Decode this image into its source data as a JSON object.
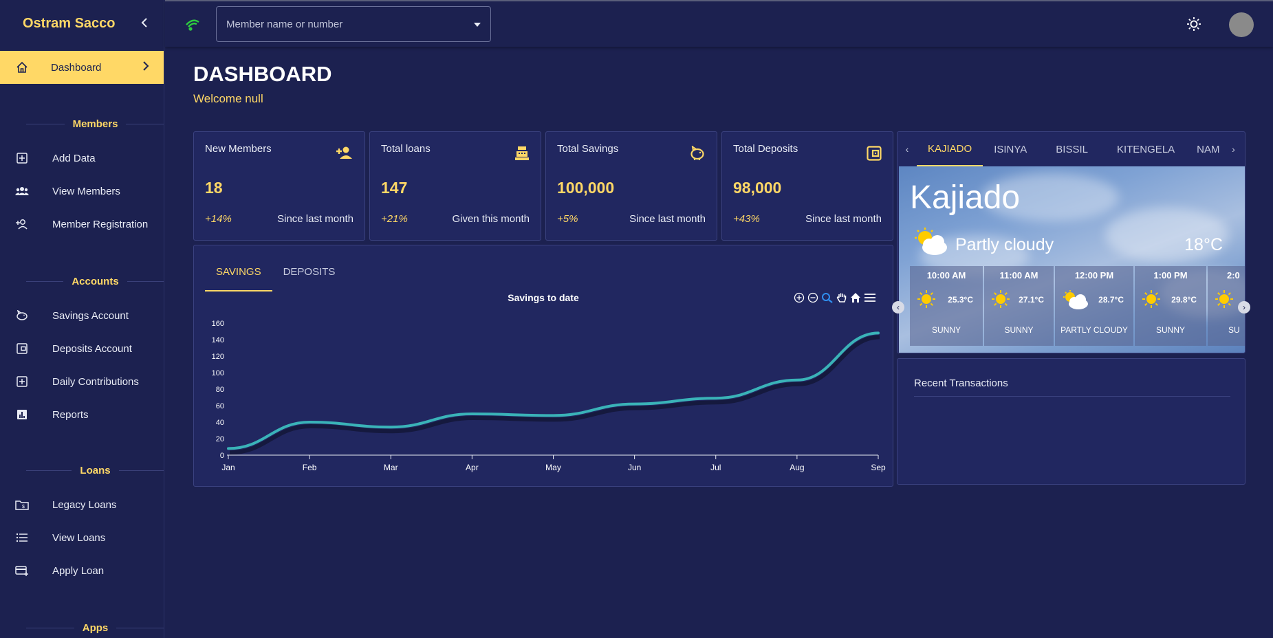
{
  "sidebar": {
    "brand": "Ostram Sacco",
    "active": {
      "label": "Dashboard"
    },
    "sections": [
      {
        "title": "Members",
        "items": [
          {
            "label": "Add Data"
          },
          {
            "label": "View Members"
          },
          {
            "label": "Member Registration"
          }
        ]
      },
      {
        "title": "Accounts",
        "items": [
          {
            "label": "Savings Account"
          },
          {
            "label": "Deposits Account"
          },
          {
            "label": "Daily Contributions"
          },
          {
            "label": "Reports"
          }
        ]
      },
      {
        "title": "Loans",
        "items": [
          {
            "label": "Legacy Loans"
          },
          {
            "label": "View Loans"
          },
          {
            "label": "Apply Loan"
          }
        ]
      },
      {
        "title": "Apps",
        "items": []
      }
    ]
  },
  "topbar": {
    "search_placeholder": "Member name or number"
  },
  "main": {
    "title": "DASHBOARD",
    "welcome": "Welcome null"
  },
  "stats": [
    {
      "title": "New Members",
      "value": "18",
      "pct": "+14%",
      "note": "Since last month",
      "icon": "person-add-icon"
    },
    {
      "title": "Total loans",
      "value": "147",
      "pct": "+21%",
      "note": "Given this month",
      "icon": "cash-register-icon"
    },
    {
      "title": "Total Savings",
      "value": "100,000",
      "pct": "+5%",
      "note": "Since last month",
      "icon": "piggy-bank-icon"
    },
    {
      "title": "Total Deposits",
      "value": "98,000",
      "pct": "+43%",
      "note": "Since last month",
      "icon": "wallet-icon"
    }
  ],
  "chart_tabs": [
    "SAVINGS",
    "DEPOSITS"
  ],
  "chart_data": {
    "type": "line",
    "title": "Savings to date",
    "categories": [
      "Jan",
      "Feb",
      "Mar",
      "Apr",
      "May",
      "Jun",
      "Jul",
      "Aug",
      "Sep"
    ],
    "values": [
      8,
      40,
      34,
      50,
      48,
      62,
      69,
      91,
      148
    ],
    "ylim": [
      0,
      160
    ],
    "yticks": [
      0,
      20,
      40,
      60,
      80,
      100,
      120,
      140,
      160
    ],
    "color": "#3ab3b8",
    "grid": false
  },
  "weather": {
    "tabs": [
      "KAJIADO",
      "ISINYA",
      "BISSIL",
      "KITENGELA",
      "NAM"
    ],
    "city": "Kajiado",
    "condition": "Partly cloudy",
    "temp": "18°C",
    "hours": [
      {
        "time": "10:00 AM",
        "temp": "25.3°C",
        "cond": "SUNNY",
        "icon": "sun-icon"
      },
      {
        "time": "11:00 AM",
        "temp": "27.1°C",
        "cond": "SUNNY",
        "icon": "sun-icon"
      },
      {
        "time": "12:00 PM",
        "temp": "28.7°C",
        "cond": "PARTLY CLOUDY",
        "icon": "partly-cloudy-icon"
      },
      {
        "time": "1:00 PM",
        "temp": "29.8°C",
        "cond": "SUNNY",
        "icon": "sun-icon"
      },
      {
        "time": "2:0",
        "temp": "",
        "cond": "SU",
        "icon": "sun-icon"
      }
    ]
  },
  "recent": {
    "title": "Recent Transactions"
  }
}
